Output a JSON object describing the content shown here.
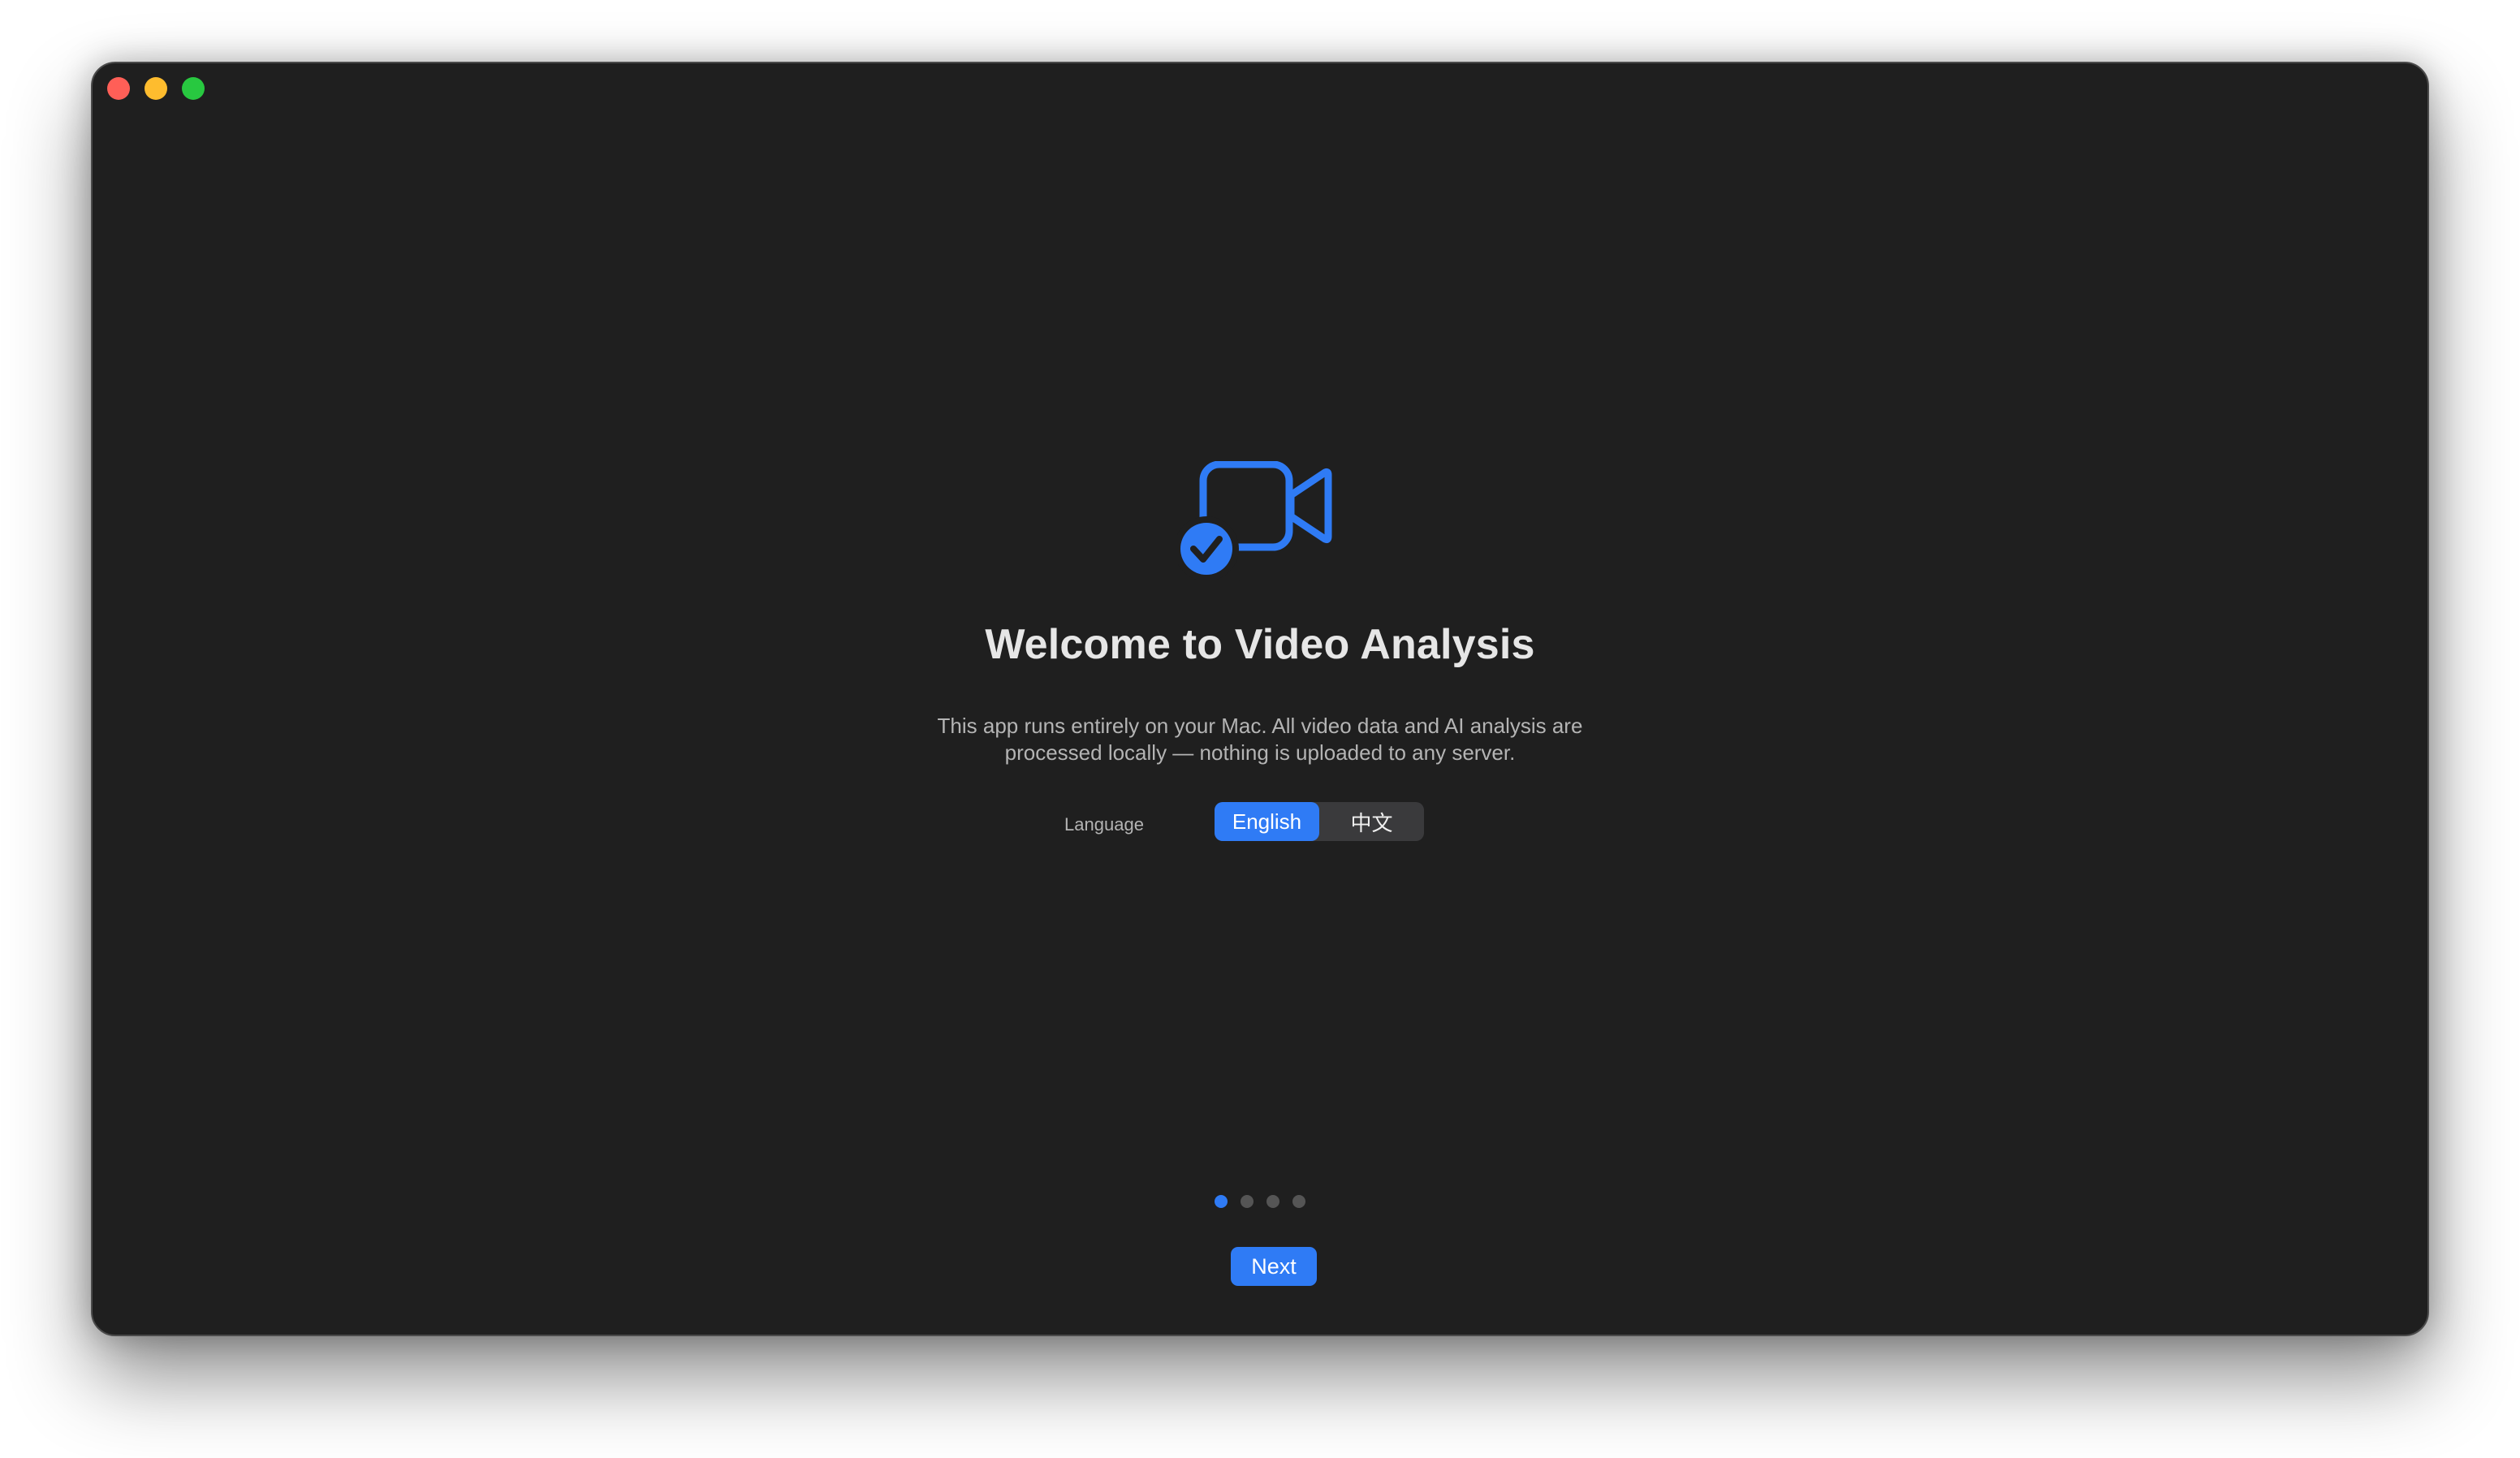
{
  "window": {
    "traffic_lights": [
      "close",
      "minimize",
      "zoom"
    ]
  },
  "onboarding": {
    "icon": "video-camera-checkmark-icon",
    "title": "Welcome to Video Analysis",
    "description_line1": "This app runs entirely on your Mac. All video data and AI analysis are",
    "description_line2": "processed locally — nothing is uploaded to any server.",
    "language": {
      "label": "Language",
      "options": [
        "English",
        "中文"
      ],
      "selected": "English"
    },
    "pagination": {
      "total_pages": 4,
      "current_page": 1
    },
    "next_label": "Next"
  },
  "colors": {
    "accent": "#2f7bf5",
    "background": "#1f1f1f",
    "title_text": "#e6e6e6",
    "secondary_text": "#b4b4b4"
  }
}
